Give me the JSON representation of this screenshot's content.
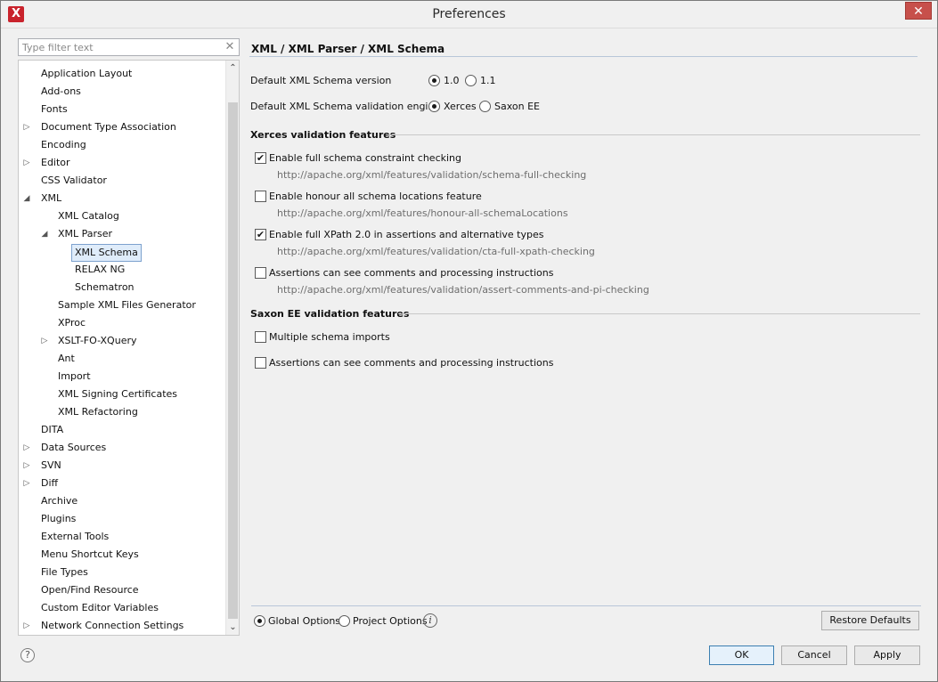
{
  "window": {
    "title": "Preferences",
    "close_glyph": "✕",
    "app_icon_glyph": "X"
  },
  "filter": {
    "placeholder": "Type filter text",
    "clear_glyph": "✕"
  },
  "tree": {
    "items": [
      {
        "label": "Application Layout",
        "expandable": false,
        "expanded": false,
        "level": 1
      },
      {
        "label": "Add-ons",
        "expandable": false,
        "expanded": false,
        "level": 1
      },
      {
        "label": "Fonts",
        "expandable": false,
        "expanded": false,
        "level": 1
      },
      {
        "label": "Document Type Association",
        "expandable": true,
        "expanded": false,
        "level": 1
      },
      {
        "label": "Encoding",
        "expandable": false,
        "expanded": false,
        "level": 1
      },
      {
        "label": "Editor",
        "expandable": true,
        "expanded": false,
        "level": 1
      },
      {
        "label": "CSS Validator",
        "expandable": false,
        "expanded": false,
        "level": 1
      },
      {
        "label": "XML",
        "expandable": true,
        "expanded": true,
        "level": 1
      },
      {
        "label": "XML Catalog",
        "expandable": false,
        "expanded": false,
        "level": 2
      },
      {
        "label": "XML Parser",
        "expandable": true,
        "expanded": true,
        "level": 2
      },
      {
        "label": "XML Schema",
        "expandable": false,
        "expanded": false,
        "level": 3,
        "selected": true
      },
      {
        "label": "RELAX NG",
        "expandable": false,
        "expanded": false,
        "level": 3
      },
      {
        "label": "Schematron",
        "expandable": false,
        "expanded": false,
        "level": 3
      },
      {
        "label": "Sample XML Files Generator",
        "expandable": false,
        "expanded": false,
        "level": 2
      },
      {
        "label": "XProc",
        "expandable": false,
        "expanded": false,
        "level": 2
      },
      {
        "label": "XSLT-FO-XQuery",
        "expandable": true,
        "expanded": false,
        "level": 2
      },
      {
        "label": "Ant",
        "expandable": false,
        "expanded": false,
        "level": 2
      },
      {
        "label": "Import",
        "expandable": false,
        "expanded": false,
        "level": 2
      },
      {
        "label": "XML Signing Certificates",
        "expandable": false,
        "expanded": false,
        "level": 2
      },
      {
        "label": "XML Refactoring",
        "expandable": false,
        "expanded": false,
        "level": 2
      },
      {
        "label": "DITA",
        "expandable": false,
        "expanded": false,
        "level": 1
      },
      {
        "label": "Data Sources",
        "expandable": true,
        "expanded": false,
        "level": 1
      },
      {
        "label": "SVN",
        "expandable": true,
        "expanded": false,
        "level": 1
      },
      {
        "label": "Diff",
        "expandable": true,
        "expanded": false,
        "level": 1
      },
      {
        "label": "Archive",
        "expandable": false,
        "expanded": false,
        "level": 1
      },
      {
        "label": "Plugins",
        "expandable": false,
        "expanded": false,
        "level": 1
      },
      {
        "label": "External Tools",
        "expandable": false,
        "expanded": false,
        "level": 1
      },
      {
        "label": "Menu Shortcut Keys",
        "expandable": false,
        "expanded": false,
        "level": 1
      },
      {
        "label": "File Types",
        "expandable": false,
        "expanded": false,
        "level": 1
      },
      {
        "label": "Open/Find Resource",
        "expandable": false,
        "expanded": false,
        "level": 1
      },
      {
        "label": "Custom Editor Variables",
        "expandable": false,
        "expanded": false,
        "level": 1
      },
      {
        "label": "Network Connection Settings",
        "expandable": true,
        "expanded": false,
        "level": 1
      }
    ]
  },
  "page": {
    "title": "XML / XML Parser / XML Schema",
    "version": {
      "label": "Default XML Schema version",
      "options": [
        "1.0",
        "1.1"
      ],
      "selected": "1.0"
    },
    "engine": {
      "label": "Default XML Schema validation engine",
      "options": [
        "Xerces",
        "Saxon EE"
      ],
      "selected": "Xerces"
    },
    "xerces": {
      "title": "Xerces validation features",
      "features": [
        {
          "label": "Enable full schema constraint checking",
          "url": "http://apache.org/xml/features/validation/schema-full-checking",
          "checked": true
        },
        {
          "label": "Enable honour all schema locations feature",
          "url": "http://apache.org/xml/features/honour-all-schemaLocations",
          "checked": false
        },
        {
          "label": "Enable full XPath 2.0 in assertions and alternative types",
          "url": "http://apache.org/xml/features/validation/cta-full-xpath-checking",
          "checked": true
        },
        {
          "label": "Assertions can see comments and processing instructions",
          "url": "http://apache.org/xml/features/validation/assert-comments-and-pi-checking",
          "checked": false
        }
      ]
    },
    "saxon": {
      "title": "Saxon EE validation features",
      "features": [
        {
          "label": "Multiple schema imports",
          "checked": false
        },
        {
          "label": "Assertions can see comments and processing instructions",
          "checked": false
        }
      ]
    },
    "scope": {
      "global_label": "Global Options",
      "project_label": "Project Options",
      "selected": "Global Options"
    },
    "restore_label": "Restore Defaults"
  },
  "footer": {
    "ok_label": "OK",
    "cancel_label": "Cancel",
    "apply_label": "Apply",
    "help_glyph": "?",
    "info_glyph": "i"
  },
  "check_glyph": "✔",
  "scroll": {
    "up_glyph": "⌃",
    "down_glyph": "⌄"
  }
}
